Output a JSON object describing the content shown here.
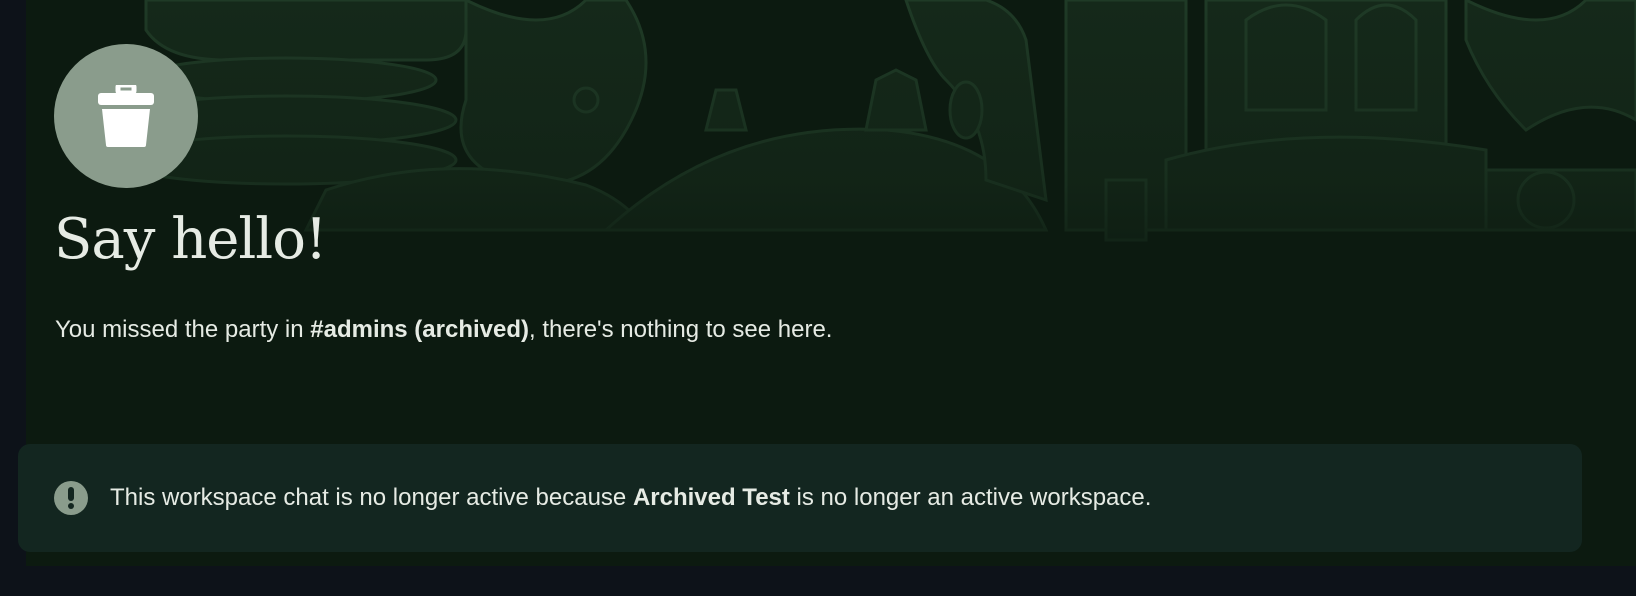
{
  "chat": {
    "avatar_icon": "trash-icon",
    "title": "Say hello!",
    "intro_prefix": "You missed the party in ",
    "room_name": "#admins (archived)",
    "intro_suffix": ", there's nothing to see here."
  },
  "notice": {
    "icon": "exclamation-icon",
    "prefix": "This workspace chat is no longer active because ",
    "workspace_name": "Archived Test",
    "suffix": " is no longer an active workspace."
  },
  "colors": {
    "panel_background": "#0c1a10",
    "page_background": "#0c111a",
    "notice_background": "#132620",
    "icon_circle": "#8a9c8c",
    "text": "#e6ebe4"
  }
}
